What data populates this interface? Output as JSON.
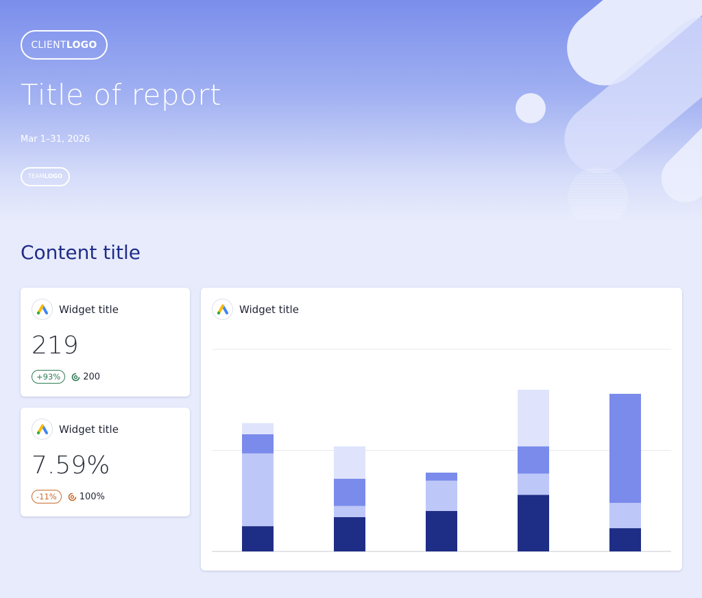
{
  "header": {
    "client_logo": {
      "light": "CLIENT",
      "bold": "LOGO"
    },
    "title": "Title of report",
    "date_range": "Mar 1–31, 2026",
    "team_logo": {
      "light": "TEAM",
      "bold": "LOGO"
    }
  },
  "content_title": "Content title",
  "widgets": [
    {
      "title": "Widget title",
      "icon": "google-ads-icon",
      "value": "219",
      "change": "+93%",
      "change_trend": "positive",
      "target": "200"
    },
    {
      "title": "Widget title",
      "icon": "google-ads-icon",
      "value": "7.59%",
      "change": "-11%",
      "change_trend": "negative",
      "target": "100%"
    }
  ],
  "chart_widget": {
    "title": "Widget title",
    "icon": "google-ads-icon"
  },
  "colors": {
    "dark": "#1e2d85",
    "light": "#bec8f8",
    "mid": "#7a8beb",
    "pale": "#dfe4fc",
    "positive": "#2f7a54",
    "negative": "#c76a2a"
  },
  "chart_data": {
    "type": "bar",
    "stacked": true,
    "categories": [
      "",
      "",
      "",
      "",
      ""
    ],
    "series": [
      {
        "color": "#1e2d85",
        "values": [
          25,
          34,
          40,
          56,
          23
        ]
      },
      {
        "color": "#bec8f8",
        "values": [
          72,
          11,
          30,
          21,
          25
        ]
      },
      {
        "color": "#7a8beb",
        "values": [
          19,
          27,
          8,
          27,
          108
        ]
      },
      {
        "color": "#dfe4fc",
        "values": [
          11,
          32,
          0,
          56,
          0
        ]
      }
    ],
    "ylim": [
      0,
      200
    ],
    "grid": true,
    "legend": "none"
  }
}
